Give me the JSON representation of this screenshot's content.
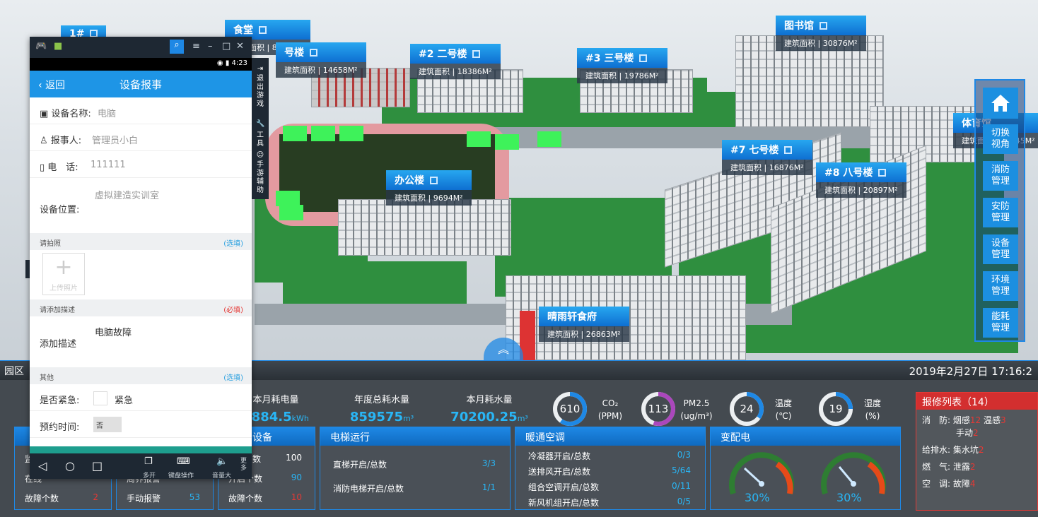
{
  "scene": {
    "buildings": [
      {
        "name": "1#",
        "area": ""
      },
      {
        "name": "食堂",
        "area": "建筑面积 | 8678M²"
      },
      {
        "name": "号楼",
        "area": "建筑面积 | 14658M²"
      },
      {
        "name": "#2 二号楼",
        "area": "建筑面积 | 18386M²"
      },
      {
        "name": "#3 三号楼",
        "area": "建筑面积 | 19786M²"
      },
      {
        "name": "图书馆",
        "area": "建筑面积 | 30876M²"
      },
      {
        "name": "体育馆",
        "area": "建筑面积 | 14545M²"
      },
      {
        "name": "办公楼",
        "area": "建筑面积 | 9694M²"
      },
      {
        "name": "#7 七号楼",
        "area": "建筑面积 | 16876M²"
      },
      {
        "name": "#8 八号楼",
        "area": "建筑面积 | 20897M²"
      },
      {
        "name": "晴雨轩食府",
        "area": "建筑面积 | 26863M²"
      }
    ]
  },
  "right_menu": [
    "切换视角",
    "消防管理",
    "安防管理",
    "设备管理",
    "环境管理",
    "能耗管理"
  ],
  "topbar": {
    "park_tab": "园区",
    "datetime": "2019年2月27日 17:16:2"
  },
  "stats": [
    {
      "label": "本月耗电量",
      "value": "7884.5",
      "unit": "kWh"
    },
    {
      "label": "年度总耗水量",
      "value": "859575",
      "unit": "m³"
    },
    {
      "label": "本月耗水量",
      "value": "70200.25",
      "unit": "m³"
    }
  ],
  "gauges": [
    {
      "value": "610",
      "label1": "CO₂",
      "label2": "(PPM)",
      "color": "#1e88e5",
      "fill": 0.6
    },
    {
      "value": "113",
      "label1": "PM2.5",
      "label2": "(ug/m³)",
      "color": "#ab47bc",
      "fill": 0.55
    },
    {
      "value": "24",
      "label1": "温度",
      "label2": "(℃)",
      "color": "#1e88e5",
      "fill": 0.35
    },
    {
      "value": "19",
      "label1": "湿度",
      "label2": "(%)",
      "color": "#1e88e5",
      "fill": 0.25
    }
  ],
  "panels": {
    "fire": {
      "title": "",
      "rows": [
        {
          "label": "监",
          "value": ""
        },
        {
          "label": "在线",
          "value": ""
        },
        {
          "label": "故障个数",
          "value": "2"
        }
      ]
    },
    "security": {
      "title": "",
      "rows": [
        {
          "label": "",
          "value": ""
        },
        {
          "label": "周界报警",
          "value": ""
        },
        {
          "label": "手动报警",
          "value": "53"
        }
      ]
    },
    "device": {
      "title": "设备",
      "rows": [
        {
          "label": "数",
          "value": "100"
        },
        {
          "label": "开启个数",
          "value": "90"
        },
        {
          "label": "故障个数",
          "value": "10"
        }
      ]
    },
    "elevator": {
      "title": "电梯运行",
      "rows": [
        {
          "label": "直梯开启/总数",
          "value": "3/3"
        },
        {
          "label": "消防电梯开启/总数",
          "value": "1/1"
        }
      ]
    },
    "hvac": {
      "title": "暖通空调",
      "rows": [
        {
          "label": "冷凝器开启/总数",
          "value": "0/3"
        },
        {
          "label": "送排风开启/总数",
          "value": "5/64"
        },
        {
          "label": "组合空调开启/总数",
          "value": "0/11"
        },
        {
          "label": "新风机组开启/总数",
          "value": "0/5"
        }
      ]
    },
    "power": {
      "title": "变配电",
      "dials": [
        {
          "value": "30%"
        },
        {
          "value": "30%"
        }
      ]
    }
  },
  "repair": {
    "title": "报修列表（14）",
    "rows": [
      {
        "cat": "消　防:",
        "items": [
          {
            "n": "烟感",
            "c": "12"
          },
          {
            "n": "温感",
            "c": "3"
          }
        ]
      },
      {
        "cat": "",
        "items": [
          {
            "n": "手动",
            "c": "2"
          }
        ]
      },
      {
        "cat": "给排水:",
        "items": [
          {
            "n": "集水坑",
            "c": "2"
          }
        ]
      },
      {
        "cat": "燃　气:",
        "items": [
          {
            "n": "泄露",
            "c": "2"
          }
        ]
      },
      {
        "cat": "空　调:",
        "items": [
          {
            "n": "故障",
            "c": "4"
          }
        ]
      }
    ]
  },
  "phone": {
    "time": "4:23",
    "back": "返回",
    "title": "设备报事",
    "fields": [
      {
        "label": "设备名称:",
        "value": "电脑"
      },
      {
        "label": "报事人:",
        "value": "管理员小白"
      },
      {
        "label": "电　话:",
        "value": "111111"
      },
      {
        "label": "设备位置:",
        "value": "虚拟建造实训室"
      }
    ],
    "photo_section": {
      "label": "请拍照",
      "right": "(选填)",
      "upload": "上传照片"
    },
    "desc_section": {
      "label": "请添加描述",
      "right": "(必填)",
      "field": "添加描述",
      "value": "电脑故障"
    },
    "other_section": {
      "label": "其他",
      "right": "(选填)"
    },
    "urgent": {
      "label": "是否紧急:",
      "value": "紧急"
    },
    "appointment": {
      "label": "预约时间:",
      "value": "否"
    },
    "nav": [
      "多开",
      "键盘操作",
      "音量大",
      "更多"
    ],
    "side": [
      "退出游戏",
      "工具",
      "手游辅助"
    ]
  }
}
